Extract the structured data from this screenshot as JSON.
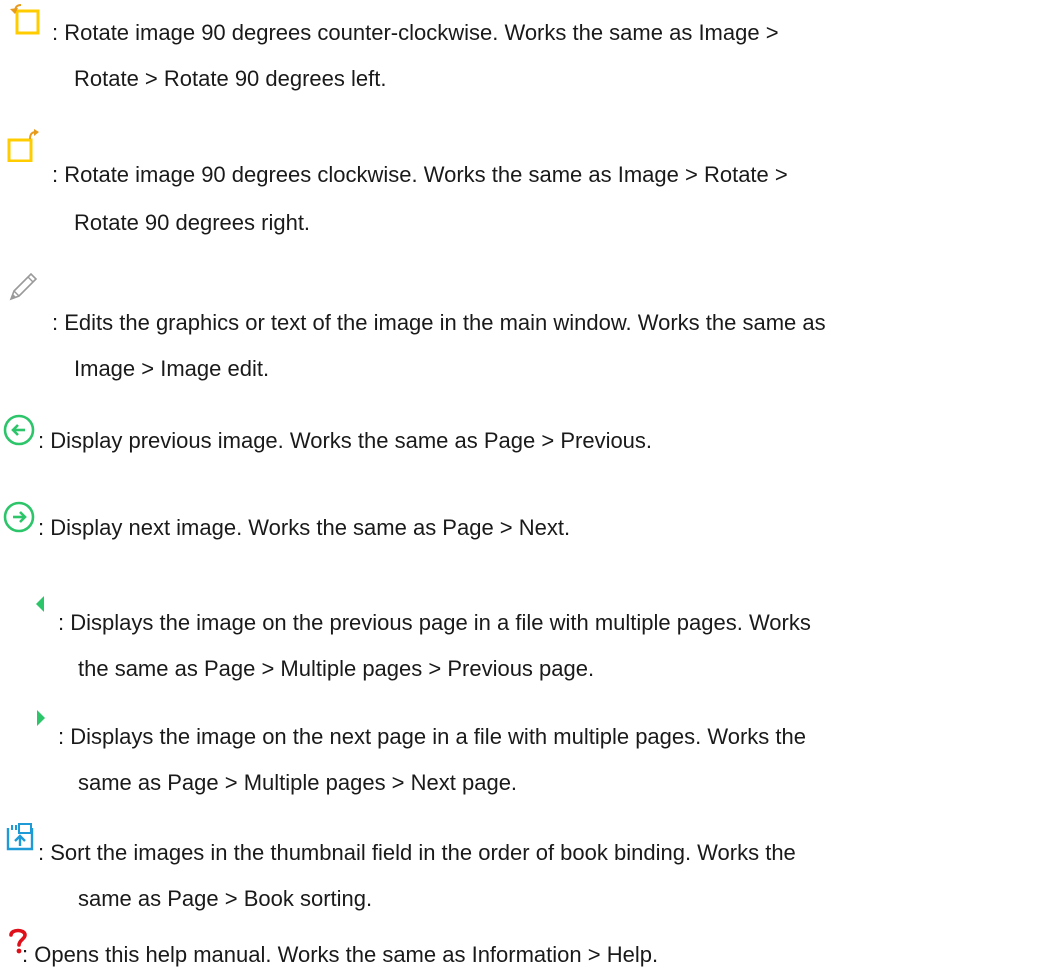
{
  "items": [
    {
      "icon": "rotate-left-icon",
      "line1": ": Rotate image 90 degrees counter-clockwise. Works the same as Image >",
      "line2": "Rotate > Rotate 90 degrees left."
    },
    {
      "icon": "rotate-right-icon",
      "line1": ": Rotate image 90 degrees clockwise. Works the same as Image > Rotate >",
      "line2": "Rotate 90 degrees right."
    },
    {
      "icon": "pencil-icon",
      "line1": ": Edits the graphics or text of the image in the main window. Works the same as",
      "line2": "Image > Image edit."
    },
    {
      "icon": "previous-image-icon",
      "line1": ": Display previous image. Works the same as Page > Previous.",
      "line2": ""
    },
    {
      "icon": "next-image-icon",
      "line1": ": Display next image. Works the same as Page > Next.",
      "line2": ""
    },
    {
      "icon": "previous-page-icon",
      "line1": ": Displays the image on the previous page in a file with multiple pages. Works",
      "line2": "the same as Page > Multiple pages > Previous page."
    },
    {
      "icon": "next-page-icon",
      "line1": ": Displays the image on the next page in a file with multiple pages. Works the",
      "line2": "same as Page > Multiple pages > Next page."
    },
    {
      "icon": "book-sorting-icon",
      "line1": ": Sort the images in the thumbnail field in the order of book binding. Works the",
      "line2": "same as Page > Book sorting."
    },
    {
      "icon": "help-icon",
      "line1": ": Opens this help manual. Works the same as Information > Help.",
      "line2": ""
    }
  ],
  "colors": {
    "accent_yellow": "#FFCC00",
    "accent_orange": "#E89A1A",
    "accent_green": "#2DC56A",
    "accent_blue": "#1E9BD7",
    "accent_red": "#E0101A",
    "text": "#1a1a1a"
  }
}
